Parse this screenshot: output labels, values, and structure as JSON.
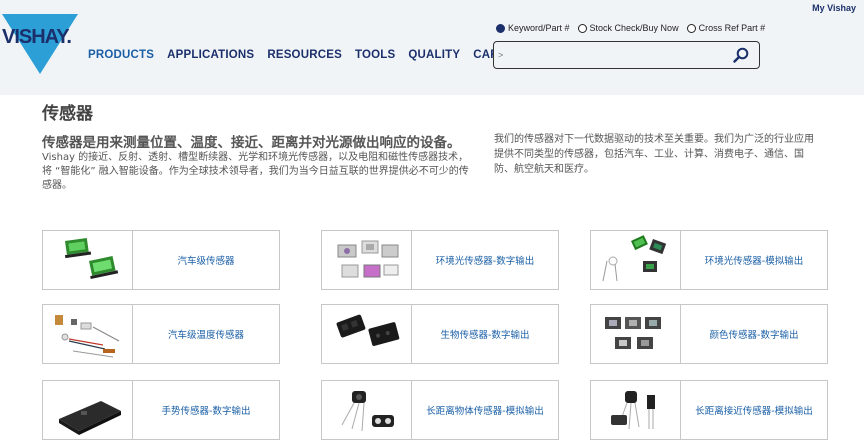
{
  "header": {
    "logo_text": "VISHAY.",
    "my_vishay": "My Vishay",
    "nav": [
      {
        "label": "PRODUCTS"
      },
      {
        "label": "APPLICATIONS"
      },
      {
        "label": "RESOURCES"
      },
      {
        "label": "TOOLS"
      },
      {
        "label": "QUALITY"
      },
      {
        "label": "CAREERS"
      }
    ],
    "search": {
      "options": [
        {
          "label": "Keyword/Part #",
          "checked": true
        },
        {
          "label": "Stock Check/Buy Now",
          "checked": false
        },
        {
          "label": "Cross Ref Part #",
          "checked": false
        }
      ],
      "placeholder": ">"
    }
  },
  "page": {
    "title": "传感器",
    "lead": "传感器是用来测量位置、温度、接近、距离并对光源做出响应的设备。",
    "desc_left": "Vishay 的接近、反射、透射、槽型断续器、光学和环境光传感器，以及电阻和磁性传感器技术，将 “智能化” 融入智能设备。作为全球技术领导者，我们为当今日益互联的世界提供必不可少的传感器。",
    "desc_right": "我们的传感器对下一代数据驱动的技术至关重要。我们为广泛的行业应用提供不同类型的传感器，包括汽车、工业、计算、消费电子、通信、国防、航空航天和医疗。"
  },
  "categories": [
    {
      "label": "汽车级传感器",
      "icon": "green-sensor-chips-icon"
    },
    {
      "label": "环境光传感器-数字输出",
      "icon": "ambient-light-sensor-chips-icon"
    },
    {
      "label": "环境光传感器-模拟输出",
      "icon": "ambient-light-analog-sensor-icon"
    },
    {
      "label": "汽车级温度传感器",
      "icon": "temperature-sensor-components-icon"
    },
    {
      "label": "生物传感器-数字输出",
      "icon": "biosensor-chips-icon"
    },
    {
      "label": "颜色传感器-数字输出",
      "icon": "color-sensor-chips-icon"
    },
    {
      "label": "手势传感器-数字输出",
      "icon": "gesture-sensor-module-icon"
    },
    {
      "label": "长距离物体传感器-模拟输出",
      "icon": "long-range-object-sensor-icon"
    },
    {
      "label": "长距离接近传感器-模拟输出",
      "icon": "long-range-proximity-sensor-icon"
    }
  ],
  "colors": {
    "brand_navy": "#1b2f6b",
    "logo_blue": "#2b9fd6",
    "link_blue": "#1a5fa6",
    "header_bg": "#f1f4f7"
  }
}
